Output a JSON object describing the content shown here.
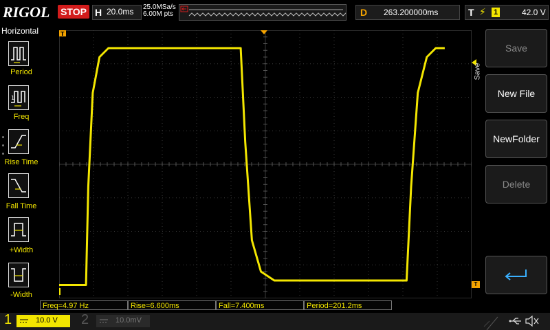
{
  "app": {
    "brand": "RIGOL",
    "run_state": "STOP"
  },
  "horizontal": {
    "label": "H",
    "timebase": "20.0ms",
    "sample_rate": "25.0MSa/s",
    "memory_depth": "6.00M pts"
  },
  "trigger_position": {
    "label": "D",
    "value": "263.200000ms"
  },
  "trigger": {
    "label": "T",
    "edge": "⚡",
    "source": "1",
    "level": "42.0 V"
  },
  "left_menu": {
    "title": "Horizontal",
    "items": [
      {
        "label": "Period"
      },
      {
        "label": "Freq"
      },
      {
        "label": "Rise Time"
      },
      {
        "label": "Fall Time"
      },
      {
        "label": "+Width"
      },
      {
        "label": "-Width"
      }
    ]
  },
  "right_menu": {
    "title": "Save",
    "items": [
      {
        "label": "Save",
        "enabled": false
      },
      {
        "label": "New File",
        "enabled": true
      },
      {
        "label": "NewFolder",
        "enabled": true
      },
      {
        "label": "Delete",
        "enabled": false
      },
      {
        "label": "",
        "enabled": true
      }
    ]
  },
  "measurements": [
    {
      "text": "Freq=4.97 Hz"
    },
    {
      "text": "Rise=6.600ms"
    },
    {
      "text": "Fall=7.400ms"
    },
    {
      "text": "Period=201.2ms"
    }
  ],
  "channels": [
    {
      "number": "1",
      "scale": "10.0 V",
      "active": true
    },
    {
      "number": "2",
      "scale": "10.0mV",
      "active": false
    }
  ],
  "colors": {
    "ch1": "#f3e600",
    "stop": "#d21c1c",
    "trigger_marker": "#f4a300",
    "grid": "#3a3a3a"
  },
  "chart_data": {
    "type": "line",
    "series": [
      {
        "x": [
          -0.6,
          -0.1,
          0.0,
          0.05,
          0.15,
          0.3,
          0.5,
          1.2,
          2.3,
          3.2,
          3.45,
          3.55,
          3.7,
          3.9,
          4.2,
          5.0,
          6.2,
          6.8,
          7.1,
          7.15,
          7.25,
          7.4,
          7.6,
          7.8,
          8.0
        ],
        "y": [
          -2.7,
          -2.7,
          -2.7,
          -0.5,
          1.6,
          2.4,
          2.6,
          2.6,
          2.6,
          2.6,
          2.6,
          0.5,
          -1.7,
          -2.4,
          -2.6,
          -2.6,
          -2.6,
          -2.6,
          -2.6,
          -2.6,
          -0.5,
          1.6,
          2.4,
          2.6,
          2.6
        ]
      }
    ],
    "xlim": [
      -0.6,
      8.6
    ],
    "ylim": [
      -3.0,
      3.0
    ],
    "grid": true
  }
}
